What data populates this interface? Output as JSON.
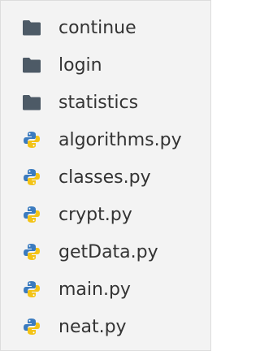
{
  "colors": {
    "folder": "#4d5a66",
    "python_blue": "#3b7bbf",
    "python_yellow": "#f3c316",
    "text": "#333333"
  },
  "items": [
    {
      "label": "continue",
      "icon": "folder-icon"
    },
    {
      "label": "login",
      "icon": "folder-icon"
    },
    {
      "label": "statistics",
      "icon": "folder-icon"
    },
    {
      "label": "algorithms.py",
      "icon": "python-file-icon"
    },
    {
      "label": "classes.py",
      "icon": "python-file-icon"
    },
    {
      "label": "crypt.py",
      "icon": "python-file-icon"
    },
    {
      "label": "getData.py",
      "icon": "python-file-icon"
    },
    {
      "label": "main.py",
      "icon": "python-file-icon"
    },
    {
      "label": "neat.py",
      "icon": "python-file-icon"
    }
  ]
}
